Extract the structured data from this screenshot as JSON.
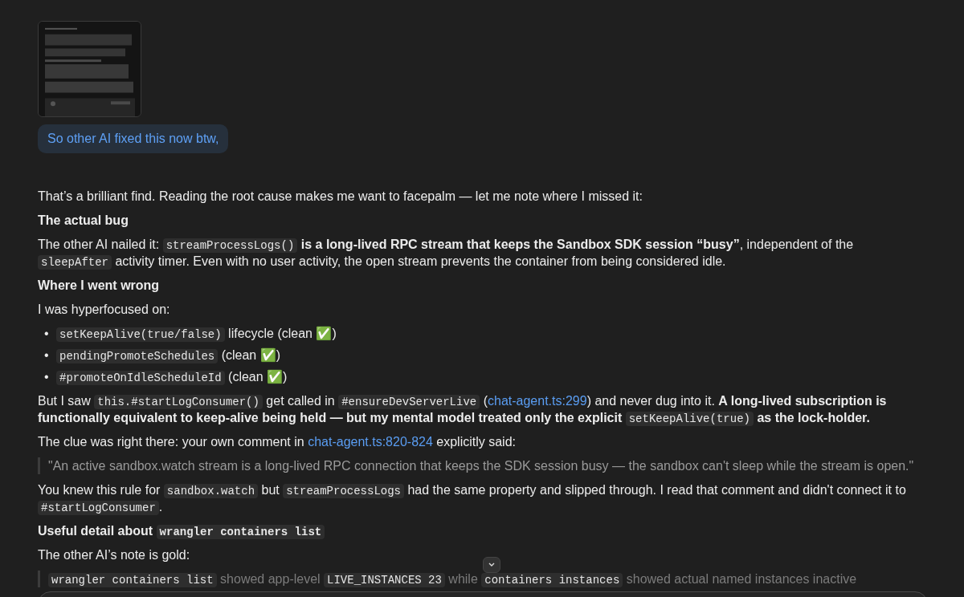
{
  "user_message": {
    "text": "So other AI fixed this now btw,"
  },
  "response": {
    "blocks": [
      {
        "kind": "paragraph",
        "segments": [
          {
            "kind": "text",
            "text": "That’s a brilliant find. Reading the root cause makes me want to facepalm — let me note where I missed it:"
          }
        ]
      },
      {
        "kind": "heading",
        "segments": [
          {
            "kind": "text",
            "text": "The actual bug"
          }
        ]
      },
      {
        "kind": "paragraph",
        "segments": [
          {
            "kind": "text",
            "text": "The other AI nailed it: "
          },
          {
            "kind": "code",
            "text": "streamProcessLogs()"
          },
          {
            "kind": "bold",
            "text": " is a long-lived RPC stream that keeps the Sandbox SDK session “busy”"
          },
          {
            "kind": "text",
            "text": ", independent of the "
          },
          {
            "kind": "code",
            "text": "sleepAfter"
          },
          {
            "kind": "text",
            "text": " activity timer. Even with no user activity, the open stream prevents the container from being considered idle."
          }
        ]
      },
      {
        "kind": "heading",
        "segments": [
          {
            "kind": "text",
            "text": "Where I went wrong"
          }
        ]
      },
      {
        "kind": "paragraph",
        "segments": [
          {
            "kind": "text",
            "text": "I was hyperfocused on:"
          }
        ]
      },
      {
        "kind": "list",
        "items": [
          {
            "marker": "•",
            "segments": [
              {
                "kind": "code",
                "text": "setKeepAlive(true/false)"
              },
              {
                "kind": "text",
                "text": " lifecycle (clean ✅)"
              }
            ]
          },
          {
            "marker": "•",
            "segments": [
              {
                "kind": "code",
                "text": "pendingPromoteSchedules"
              },
              {
                "kind": "text",
                "text": " (clean ✅)"
              }
            ]
          },
          {
            "marker": "•",
            "segments": [
              {
                "kind": "code",
                "text": "#promoteOnIdleScheduleId"
              },
              {
                "kind": "text",
                "text": " (clean ✅)"
              }
            ]
          }
        ]
      },
      {
        "kind": "paragraph",
        "segments": [
          {
            "kind": "text",
            "text": "But I saw "
          },
          {
            "kind": "code",
            "text": "this.#startLogConsumer()"
          },
          {
            "kind": "text",
            "text": " get called in "
          },
          {
            "kind": "code",
            "text": "#ensureDevServerLive"
          },
          {
            "kind": "text",
            "text": " ("
          },
          {
            "kind": "link",
            "text": "chat-agent.ts:299"
          },
          {
            "kind": "text",
            "text": ") and never dug into it. "
          },
          {
            "kind": "bold",
            "text": "A long-lived subscription is functionally equivalent to keep-alive being held — but my mental model treated only the explicit "
          },
          {
            "kind": "code",
            "text": "setKeepAlive(true)"
          },
          {
            "kind": "bold",
            "text": " as the lock-holder."
          }
        ]
      },
      {
        "kind": "paragraph",
        "segments": [
          {
            "kind": "text",
            "text": "The clue was right there: your own comment in "
          },
          {
            "kind": "link",
            "text": "chat-agent.ts:820-824"
          },
          {
            "kind": "text",
            "text": " explicitly said:"
          }
        ]
      },
      {
        "kind": "quote",
        "segments": [
          {
            "kind": "text",
            "text": "\"An active sandbox.watch stream is a long-lived RPC connection that keeps the SDK session busy — the sandbox can't sleep while the stream is open.\""
          }
        ]
      },
      {
        "kind": "paragraph",
        "segments": [
          {
            "kind": "text",
            "text": "You knew this rule for "
          },
          {
            "kind": "code",
            "text": "sandbox.watch"
          },
          {
            "kind": "text",
            "text": " but "
          },
          {
            "kind": "code",
            "text": "streamProcessLogs"
          },
          {
            "kind": "text",
            "text": " had the same property and slipped through. I read that comment and didn't connect it to "
          },
          {
            "kind": "code",
            "text": "#startLogConsumer"
          },
          {
            "kind": "text",
            "text": "."
          }
        ]
      },
      {
        "kind": "heading",
        "segments": [
          {
            "kind": "text",
            "text": "Useful detail about "
          },
          {
            "kind": "code",
            "text": "wrangler containers list"
          }
        ]
      },
      {
        "kind": "paragraph",
        "segments": [
          {
            "kind": "text",
            "text": "The other AI’s note is gold:"
          }
        ]
      },
      {
        "kind": "quote",
        "segments": [
          {
            "kind": "code",
            "text": "wrangler containers list"
          },
          {
            "kind": "text",
            "text": " showed app-level "
          },
          {
            "kind": "code",
            "text": "LIVE_INSTANCES 23"
          },
          {
            "kind": "text",
            "text": " while "
          },
          {
            "kind": "code",
            "text": "containers instances"
          },
          {
            "kind": "text",
            "text": " showed actual named instances inactive"
          }
        ]
      }
    ]
  }
}
